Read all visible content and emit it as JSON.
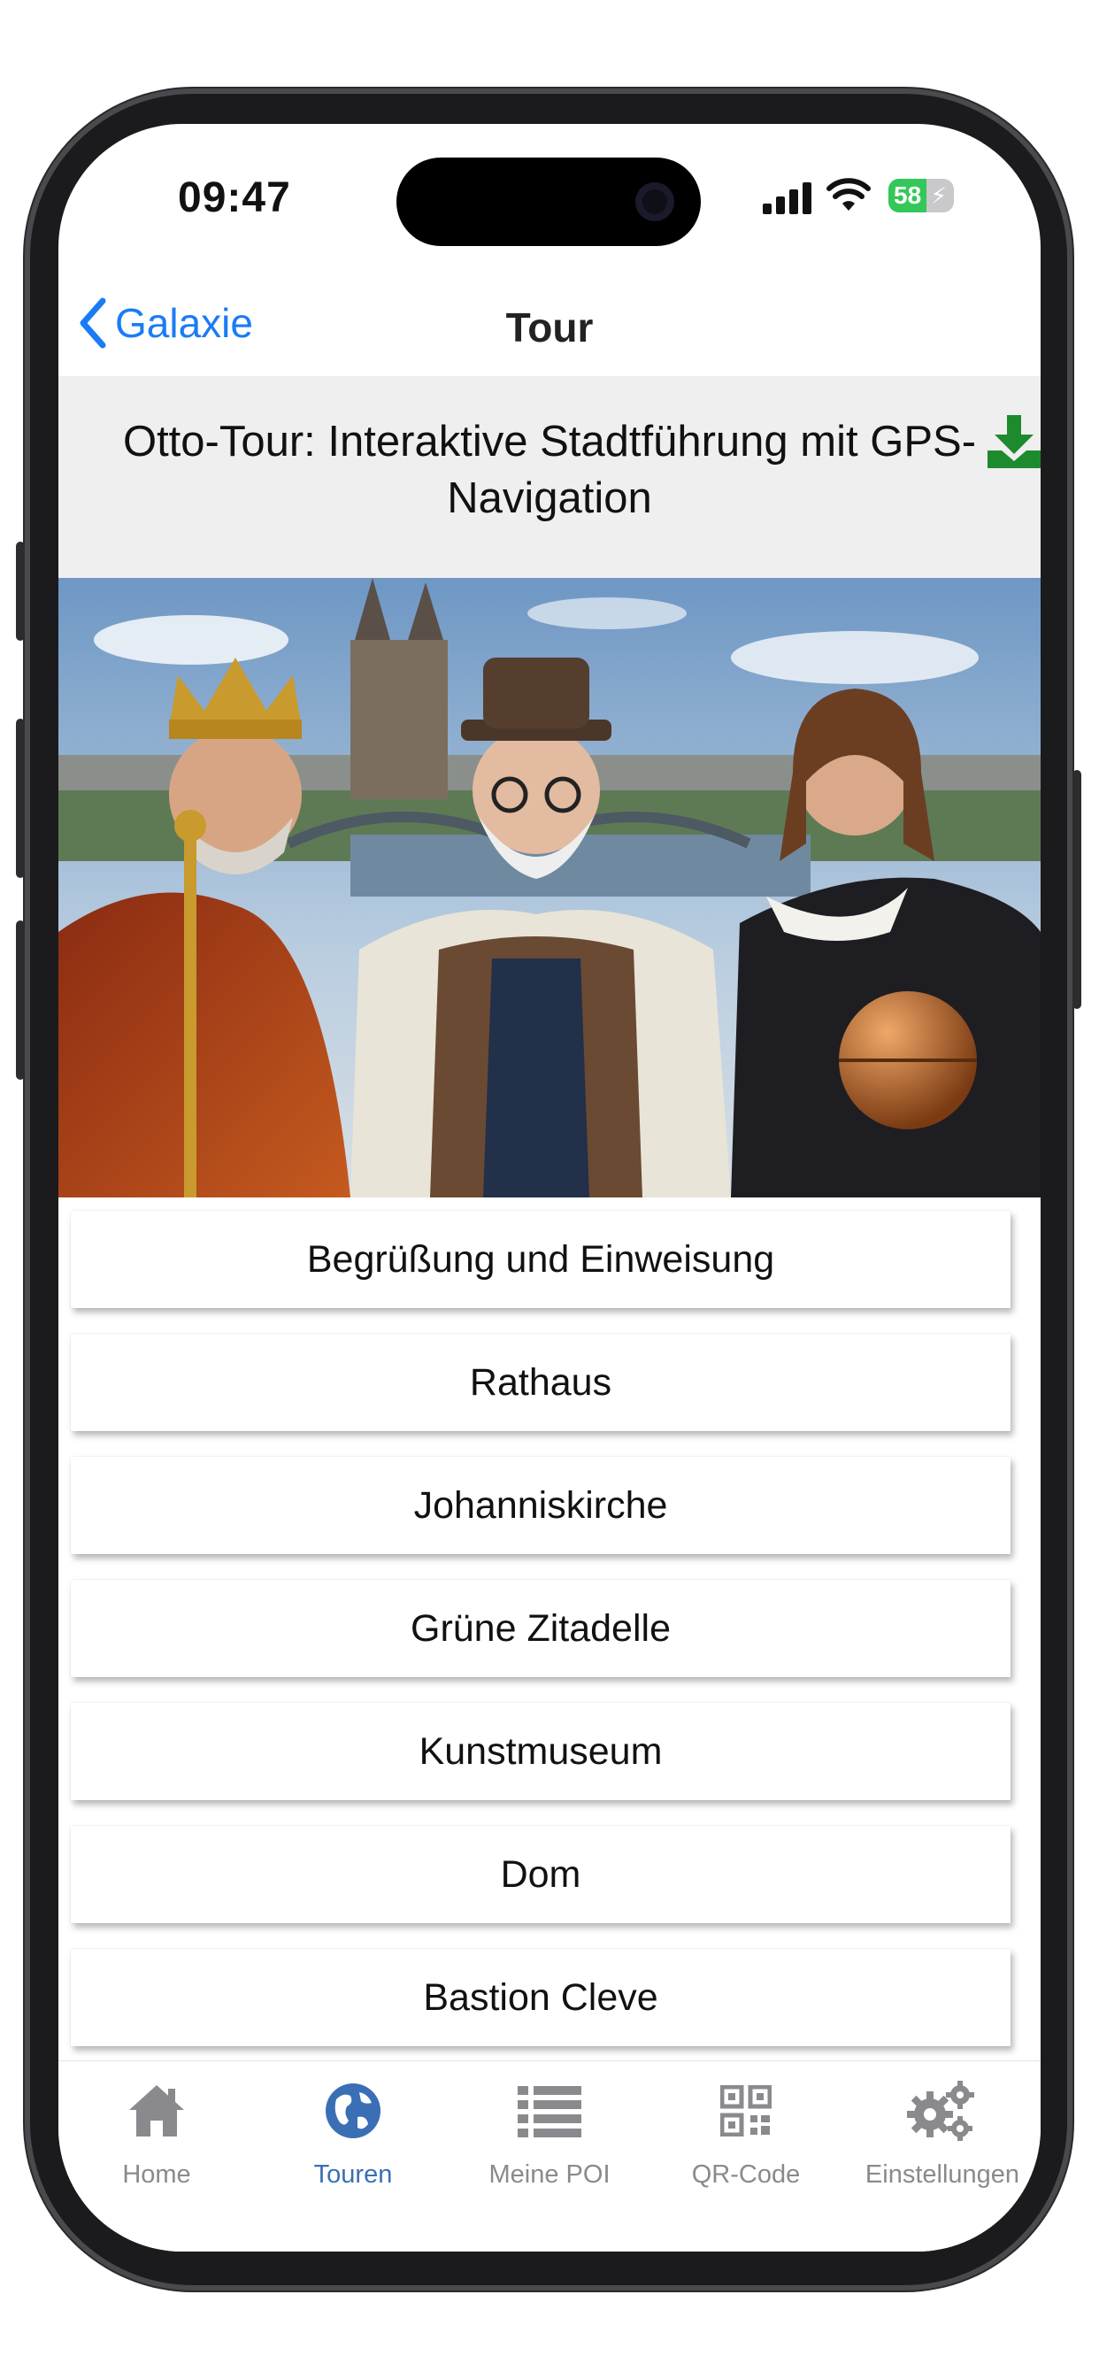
{
  "status_bar": {
    "time": "09:47",
    "battery": "58"
  },
  "nav": {
    "back_label": "Galaxie",
    "title": "Tour"
  },
  "header": {
    "title": "Otto-Tour: Interaktive Stadtführung mit GPS-Navigation"
  },
  "stops": [
    "Begrüßung und Einweisung",
    "Rathaus",
    "Johanniskirche",
    "Grüne Zitadelle",
    "Kunstmuseum",
    "Dom",
    "Bastion Cleve"
  ],
  "tabbar": {
    "active": "Touren",
    "tabs": [
      {
        "label": "Home",
        "icon": "home-icon"
      },
      {
        "label": "Touren",
        "icon": "globe-icon"
      },
      {
        "label": "Meine POI",
        "icon": "list-icon"
      },
      {
        "label": "QR-Code",
        "icon": "qr-code-icon"
      },
      {
        "label": "Einstellungen",
        "icon": "gears-icon"
      }
    ]
  },
  "colors": {
    "accent": "#1a7cf5",
    "active_tab": "#3a6fb5",
    "inactive_tab": "#8a8a8e",
    "download": "#1e8a2e",
    "header_bg": "#efefef"
  }
}
